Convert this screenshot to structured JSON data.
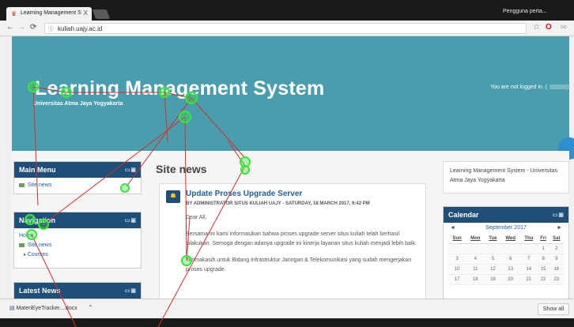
{
  "browser": {
    "tab_title": "Learning Management S",
    "tab_favicon": "moodle-hat-icon",
    "tab_close": "X",
    "profile_label": "Pengguna perta...",
    "url": "kuliah.uajy.ac.id"
  },
  "header": {
    "title": "Learning Management System",
    "subtitle": "Universitas Atma Jaya Yogyakarta",
    "login_text": "You are not logged in. ("
  },
  "main_menu": {
    "title": "Main Menu",
    "items": [
      {
        "label": "Site news"
      }
    ]
  },
  "navigation": {
    "title": "Navigation",
    "home": "Home",
    "site_news": "Site news",
    "courses": "Courses"
  },
  "latest_news": {
    "title": "Latest News"
  },
  "main": {
    "section_title": "Site news",
    "post": {
      "title": "Update Proses Upgrade Server",
      "meta": "BY ADMINISTRATOR SITUS KULIAH UAJY - SATURDAY, 18 MARCH 2017, 9:42 PM",
      "greeting": "Dear All,",
      "para1": "Bersama ini kami informasikan bahwa proses upgrade server situs kuliah telah berhasil dilakukan. Semoga dengan adanya upgrade ini kinerja layanan situs kuliah menjadi lebih baik.",
      "para2": "Terimakasih untuk Bidang Infrastruktur Jaringan & Telekomunikasi yang sudah mengerjakan proses upgrade."
    }
  },
  "info_box": {
    "text": "Learning Management System - Universitas Atma Jaya Yogyakarta"
  },
  "calendar": {
    "title": "Calendar",
    "month": "September 2017",
    "prev": "◄",
    "next": "►",
    "days": [
      "Sun",
      "Mon",
      "Tue",
      "Wed",
      "Thu",
      "Fri",
      "Sat"
    ],
    "weeks": [
      [
        "",
        "",
        "",
        "",
        "",
        "1",
        "2"
      ],
      [
        "3",
        "4",
        "5",
        "6",
        "7",
        "8",
        "9"
      ],
      [
        "10",
        "11",
        "12",
        "13",
        "14",
        "15",
        "16"
      ],
      [
        "17",
        "18",
        "19",
        "20",
        "21",
        "22",
        "23"
      ]
    ]
  },
  "download_bar": {
    "file": "MateriEyeTracker....docx",
    "show_all": "Show all"
  },
  "colors": {
    "header": "#4a9dac",
    "block_head": "#1f4e79",
    "link": "#1f5fa8",
    "gaze_line": "#d32f2f",
    "fixation": "#39e639"
  }
}
